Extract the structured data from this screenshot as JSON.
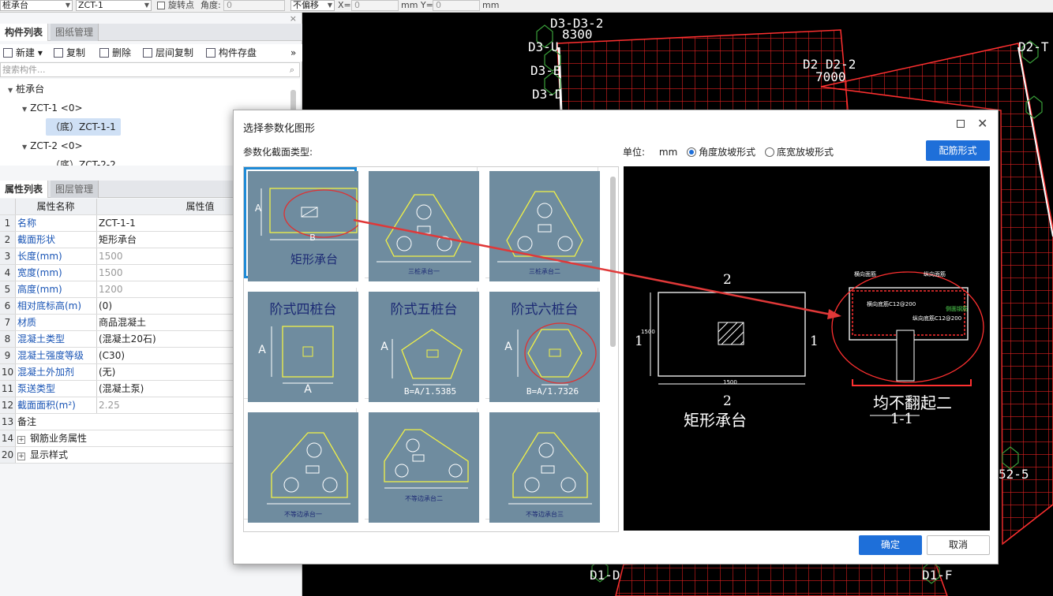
{
  "toolbar": {
    "type_select": "桩承台",
    "component_select": "ZCT-1",
    "rotate_label": "旋转点",
    "angle_label": "角度:",
    "angle_value": "0",
    "offset_select": "不偏移",
    "x_label": "X=",
    "x_value": "0",
    "mm_y_label": "mm Y=",
    "y_value": "0",
    "mm_label": "mm"
  },
  "component_panel": {
    "tabs": [
      "构件列表",
      "图纸管理"
    ],
    "close_icon": "×",
    "actions": {
      "new": "新建",
      "copy": "复制",
      "delete": "删除",
      "floor_copy": "层间复制",
      "save": "构件存盘"
    },
    "more": "»",
    "search_placeholder": "搜索构件...",
    "tree": {
      "root": "桩承台",
      "node1": "ZCT-1 <0>",
      "node1_child": "（底）ZCT-1-1",
      "node2": "ZCT-2 <0>",
      "node2_child": "（底）ZCT-2-2"
    }
  },
  "property_panel": {
    "tabs": [
      "属性列表",
      "图层管理"
    ],
    "header": {
      "name": "属性名称",
      "value": "属性值"
    },
    "rows": [
      {
        "num": "1",
        "name": "名称",
        "value": "ZCT-1-1"
      },
      {
        "num": "2",
        "name": "截面形状",
        "value": "矩形承台"
      },
      {
        "num": "3",
        "name": "长度(mm)",
        "value": "1500"
      },
      {
        "num": "4",
        "name": "宽度(mm)",
        "value": "1500"
      },
      {
        "num": "5",
        "name": "高度(mm)",
        "value": "1200"
      },
      {
        "num": "6",
        "name": "相对底标高(m)",
        "value": "(0)"
      },
      {
        "num": "7",
        "name": "材质",
        "value": "商品混凝土"
      },
      {
        "num": "8",
        "name": "混凝土类型",
        "value": "(混凝土20石)"
      },
      {
        "num": "9",
        "name": "混凝土强度等级",
        "value": "(C30)"
      },
      {
        "num": "10",
        "name": "混凝土外加剂",
        "value": "(无)"
      },
      {
        "num": "11",
        "name": "泵送类型",
        "value": "(混凝土泵)"
      },
      {
        "num": "12",
        "name": "截面面积(m²)",
        "value": "2.25"
      },
      {
        "num": "13",
        "name": "备注",
        "value": ""
      },
      {
        "num": "14",
        "name": "钢筋业务属性",
        "value": ""
      },
      {
        "num": "20",
        "name": "显示样式",
        "value": ""
      }
    ]
  },
  "cad_labels": {
    "d3": "D3-D3-2",
    "n8300": "8300",
    "d3u": "D3-U",
    "d3b": "D3-B",
    "d3c": "D3-D",
    "d2": "D2 D2-2",
    "n7000": "7000",
    "d2t": "D2-T",
    "d1": "D1-D",
    "d1f": "D1-F",
    "s52": "52-5",
    "s52b": "52-5"
  },
  "dialog": {
    "title": "选择参数化图形",
    "section_label": "参数化截面类型:",
    "unit_label": "单位:",
    "unit_value": "mm",
    "radio_angle": "角度放坡形式",
    "radio_width": "底宽放坡形式",
    "rebar_button": "配筋形式",
    "ok": "确定",
    "cancel": "取消",
    "shapes": [
      {
        "title": "",
        "caption": "矩形承台",
        "dim_a": "A",
        "dim_b": "B"
      },
      {
        "title": "",
        "caption": "三桩承台一"
      },
      {
        "title": "",
        "caption": "三桩承台二"
      },
      {
        "title": "阶式四桩台",
        "caption": "A",
        "dim_a": "A"
      },
      {
        "title": "阶式五桩台",
        "caption": "B=A/1.5385",
        "dim_a": "A"
      },
      {
        "title": "阶式六桩台",
        "caption": "B=A/1.7326",
        "dim_a": "A"
      },
      {
        "title": "",
        "caption": "不等边承台一"
      },
      {
        "title": "",
        "caption": "不等边承台二"
      },
      {
        "title": "",
        "caption": "不等边承台三"
      }
    ],
    "preview": {
      "section_top": "2",
      "section_bottom": "2",
      "side_left": "1",
      "side_right": "1",
      "dim_h": "1500",
      "dim_v": "1500",
      "plan_caption": "矩形承台",
      "detail_caption": "均不翻起二",
      "detail_section": "1-1",
      "rebar_labels": [
        "横向面筋",
        "纵向面筋",
        "横向底筋C12@200",
        "纵向底筋C12@200",
        "侧面钢筋"
      ]
    }
  }
}
